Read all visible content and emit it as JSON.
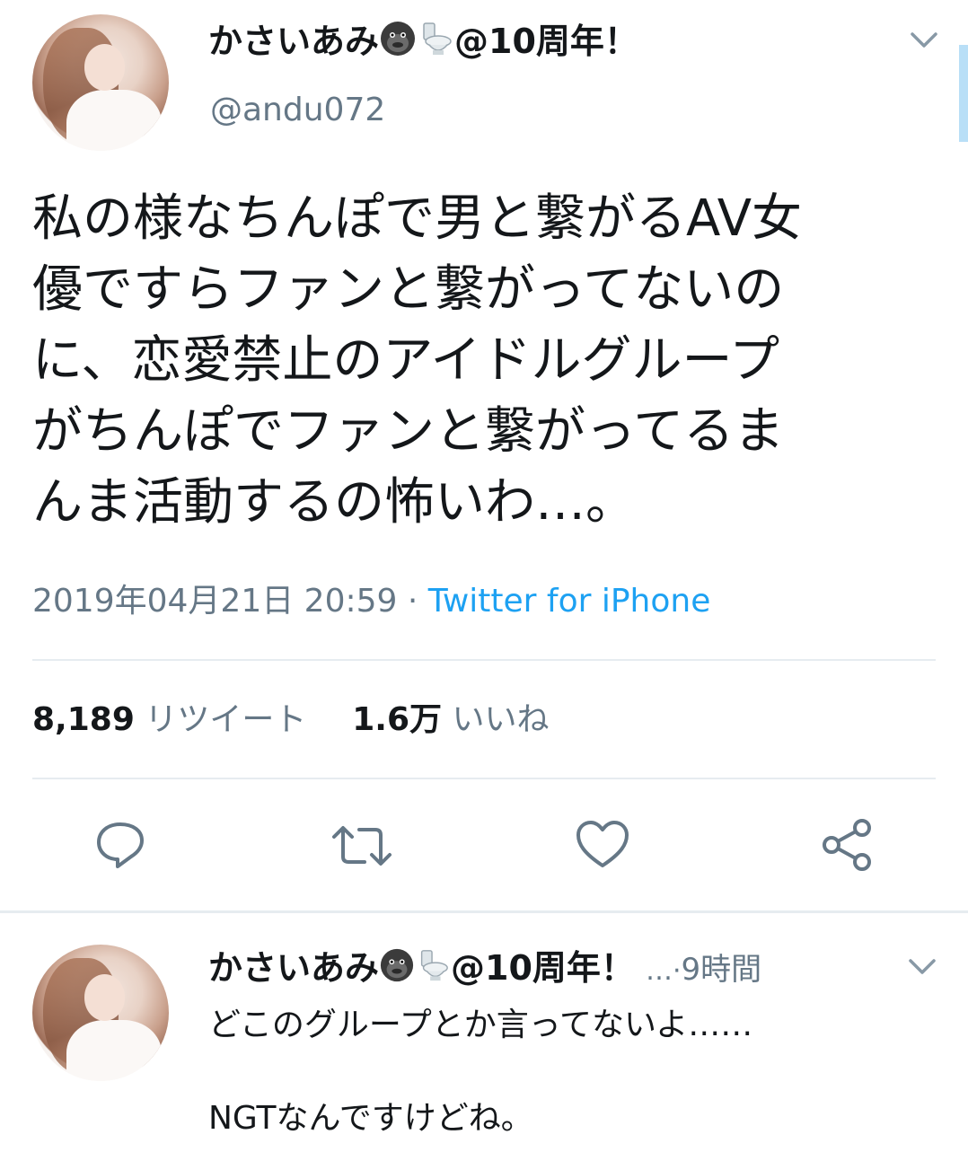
{
  "tweet": {
    "author": {
      "display_name": "かさいあみ",
      "name_suffix": "@10周年！",
      "handle": "@andu072",
      "emoji_1": "gorilla-icon",
      "emoji_2": "toilet-icon"
    },
    "text_lines": [
      "私の様なちんぽで男と繋がるAV女",
      "優ですらファンと繋がってないの",
      "に、恋愛禁止のアイドルグループ",
      "がちんぽでファンと繋がってるま",
      "んま活動するの怖いわ…。"
    ],
    "date": "2019年04月21日 20:59",
    "separator": "·",
    "source": "Twitter for iPhone",
    "stats": {
      "retweets_count": "8,189",
      "retweets_label": "リツイート",
      "likes_count": "1.6万",
      "likes_label": "いいね"
    },
    "actions": [
      "reply-icon",
      "retweet-icon",
      "like-icon",
      "share-icon"
    ]
  },
  "reply": {
    "author": {
      "display_name": "かさいあみ",
      "name_suffix": "@10周年！",
      "truncation": "…",
      "separator": "·",
      "time": "9時間"
    },
    "text_lines": [
      "どこのグループとか言ってないよ……",
      "",
      "NGTなんですけどね。"
    ]
  },
  "colors": {
    "link": "#1da1f2",
    "muted": "#657786",
    "text": "#14171a",
    "divider": "#e6ecf0"
  }
}
